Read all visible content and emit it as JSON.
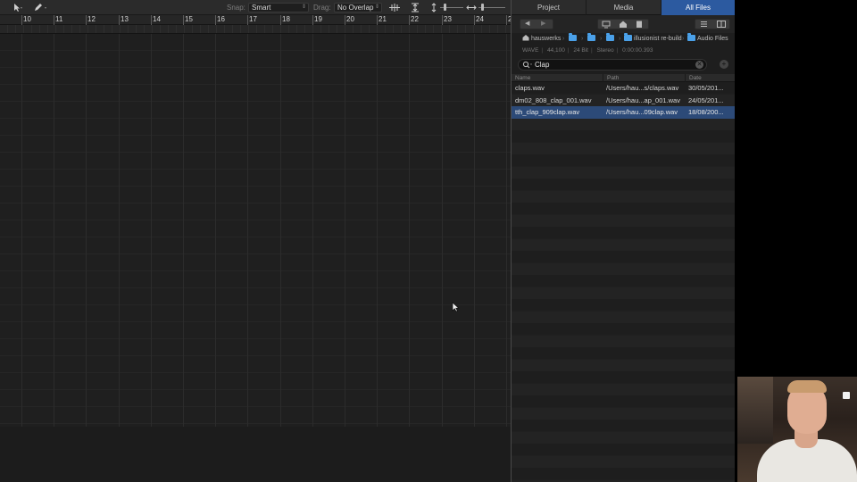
{
  "toolbar": {
    "pointer_tool_icon": "pointer-icon",
    "pencil_tool_icon": "pencil-icon",
    "snap_label": "Snap:",
    "snap_value": "Smart",
    "drag_label": "Drag:",
    "drag_value": "No Overlap"
  },
  "ruler": {
    "bars": [
      "10",
      "11",
      "12",
      "13",
      "14",
      "15",
      "16",
      "17",
      "18",
      "19",
      "20",
      "21",
      "22",
      "23",
      "24",
      "2"
    ]
  },
  "browser": {
    "tabs": [
      {
        "label": "Project",
        "active": false
      },
      {
        "label": "Media",
        "active": false
      },
      {
        "label": "All Files",
        "active": true
      }
    ],
    "nav": {
      "back_icon": "back-arrow-icon",
      "forward_icon": "forward-arrow-icon",
      "computer_icon": "computer-icon",
      "home_icon": "home-icon",
      "project_icon": "document-icon",
      "list_view_icon": "list-view-icon",
      "column_view_icon": "column-view-icon"
    },
    "path": {
      "home": "hauswerks",
      "folder4": "illusionist re-build",
      "folder5": "Audio Files"
    },
    "info": {
      "format": "WAVE",
      "sample_rate": "44,100",
      "bit_depth": "24 Bit",
      "channels": "Stereo",
      "duration": "0:00:00.393"
    },
    "search": {
      "value": "Clap"
    },
    "columns": {
      "name": "Name",
      "path": "Path",
      "date": "Date"
    },
    "files": [
      {
        "name": "claps.wav",
        "path": "/Users/hau...s/claps.wav",
        "date": "30/05/201..."
      },
      {
        "name": "dm02_808_clap_001.wav",
        "path": "/Users/hau...ap_001.wav",
        "date": "24/05/201..."
      },
      {
        "name": "tth_clap_909clap.wav",
        "path": "/Users/hau...09clap.wav",
        "date": "18/08/200..."
      }
    ]
  }
}
